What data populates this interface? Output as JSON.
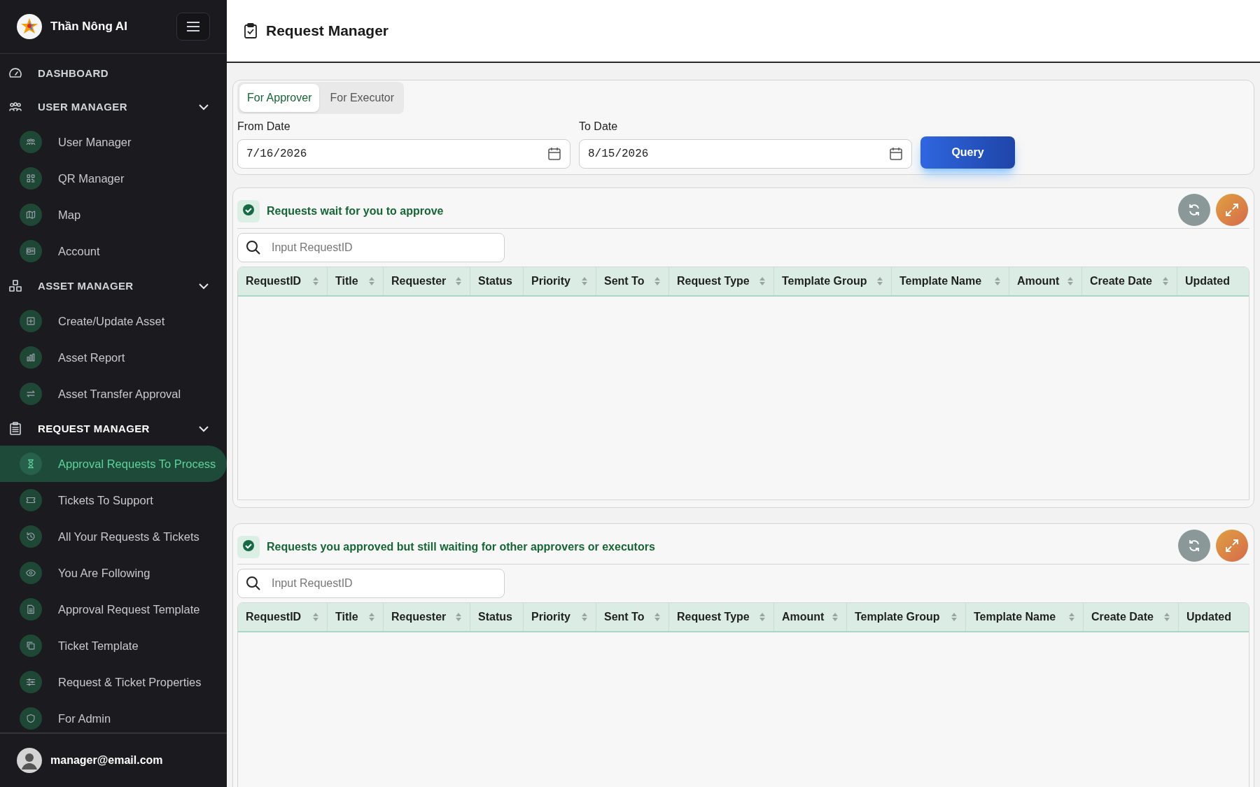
{
  "brand": {
    "name": "Thần Nông AI"
  },
  "sidebar": {
    "groups": [
      {
        "label": "DASHBOARD"
      },
      {
        "label": "USER MANAGER",
        "expanded": true,
        "items": [
          {
            "label": "User Manager",
            "selected": false
          },
          {
            "label": "QR Manager",
            "selected": false
          },
          {
            "label": "Map",
            "selected": false
          },
          {
            "label": "Account",
            "selected": false
          }
        ]
      },
      {
        "label": "ASSET MANAGER",
        "expanded": true,
        "items": [
          {
            "label": "Create/Update Asset",
            "selected": false
          },
          {
            "label": "Asset Report",
            "selected": false
          },
          {
            "label": "Asset Transfer Approval",
            "selected": false
          }
        ]
      },
      {
        "label": "REQUEST MANAGER",
        "expanded": true,
        "items": [
          {
            "label": "Approval Requests To Process",
            "selected": true
          },
          {
            "label": "Tickets To Support",
            "selected": false
          },
          {
            "label": "All Your Requests & Tickets",
            "selected": false
          },
          {
            "label": "You Are Following",
            "selected": false
          },
          {
            "label": "Approval Request Template",
            "selected": false
          },
          {
            "label": "Ticket Template",
            "selected": false
          },
          {
            "label": "Request & Ticket Properties",
            "selected": false
          },
          {
            "label": "For Admin",
            "selected": false
          }
        ]
      }
    ],
    "user": {
      "email": "manager@email.com"
    }
  },
  "header": {
    "title": "Request Manager"
  },
  "filter": {
    "tabs": [
      {
        "label": "For Approver",
        "selected": true
      },
      {
        "label": "For Executor",
        "selected": false
      }
    ],
    "from_date": {
      "label": "From Date",
      "value": "7/16/2026"
    },
    "to_date": {
      "label": "To Date",
      "value": "8/15/2026"
    },
    "query_button": "Query"
  },
  "sections": [
    {
      "title": "Requests wait for you to approve",
      "search": {
        "placeholder": "Input RequestID"
      },
      "columns": [
        {
          "label": "RequestID",
          "sortable": true
        },
        {
          "label": "Title",
          "sortable": true
        },
        {
          "label": "Requester",
          "sortable": true
        },
        {
          "label": "Status",
          "sortable": false
        },
        {
          "label": "Priority",
          "sortable": true
        },
        {
          "label": "Sent To",
          "sortable": true
        },
        {
          "label": "Request Type",
          "sortable": true
        },
        {
          "label": "Template Group",
          "sortable": true
        },
        {
          "label": "Template Name",
          "sortable": true
        },
        {
          "label": "Amount",
          "sortable": true
        },
        {
          "label": "Create Date",
          "sortable": true
        },
        {
          "label": "Updated",
          "sortable": false
        }
      ]
    },
    {
      "title": "Requests you approved but still waiting for other approvers or executors",
      "search": {
        "placeholder": "Input RequestID"
      },
      "columns": [
        {
          "label": "RequestID",
          "sortable": true
        },
        {
          "label": "Title",
          "sortable": true
        },
        {
          "label": "Requester",
          "sortable": true
        },
        {
          "label": "Status",
          "sortable": false
        },
        {
          "label": "Priority",
          "sortable": true
        },
        {
          "label": "Sent To",
          "sortable": true
        },
        {
          "label": "Request Type",
          "sortable": true
        },
        {
          "label": "Amount",
          "sortable": true
        },
        {
          "label": "Template Group",
          "sortable": true
        },
        {
          "label": "Template Name",
          "sortable": true
        },
        {
          "label": "Create Date",
          "sortable": true
        },
        {
          "label": "Updated",
          "sortable": false
        }
      ]
    }
  ]
}
